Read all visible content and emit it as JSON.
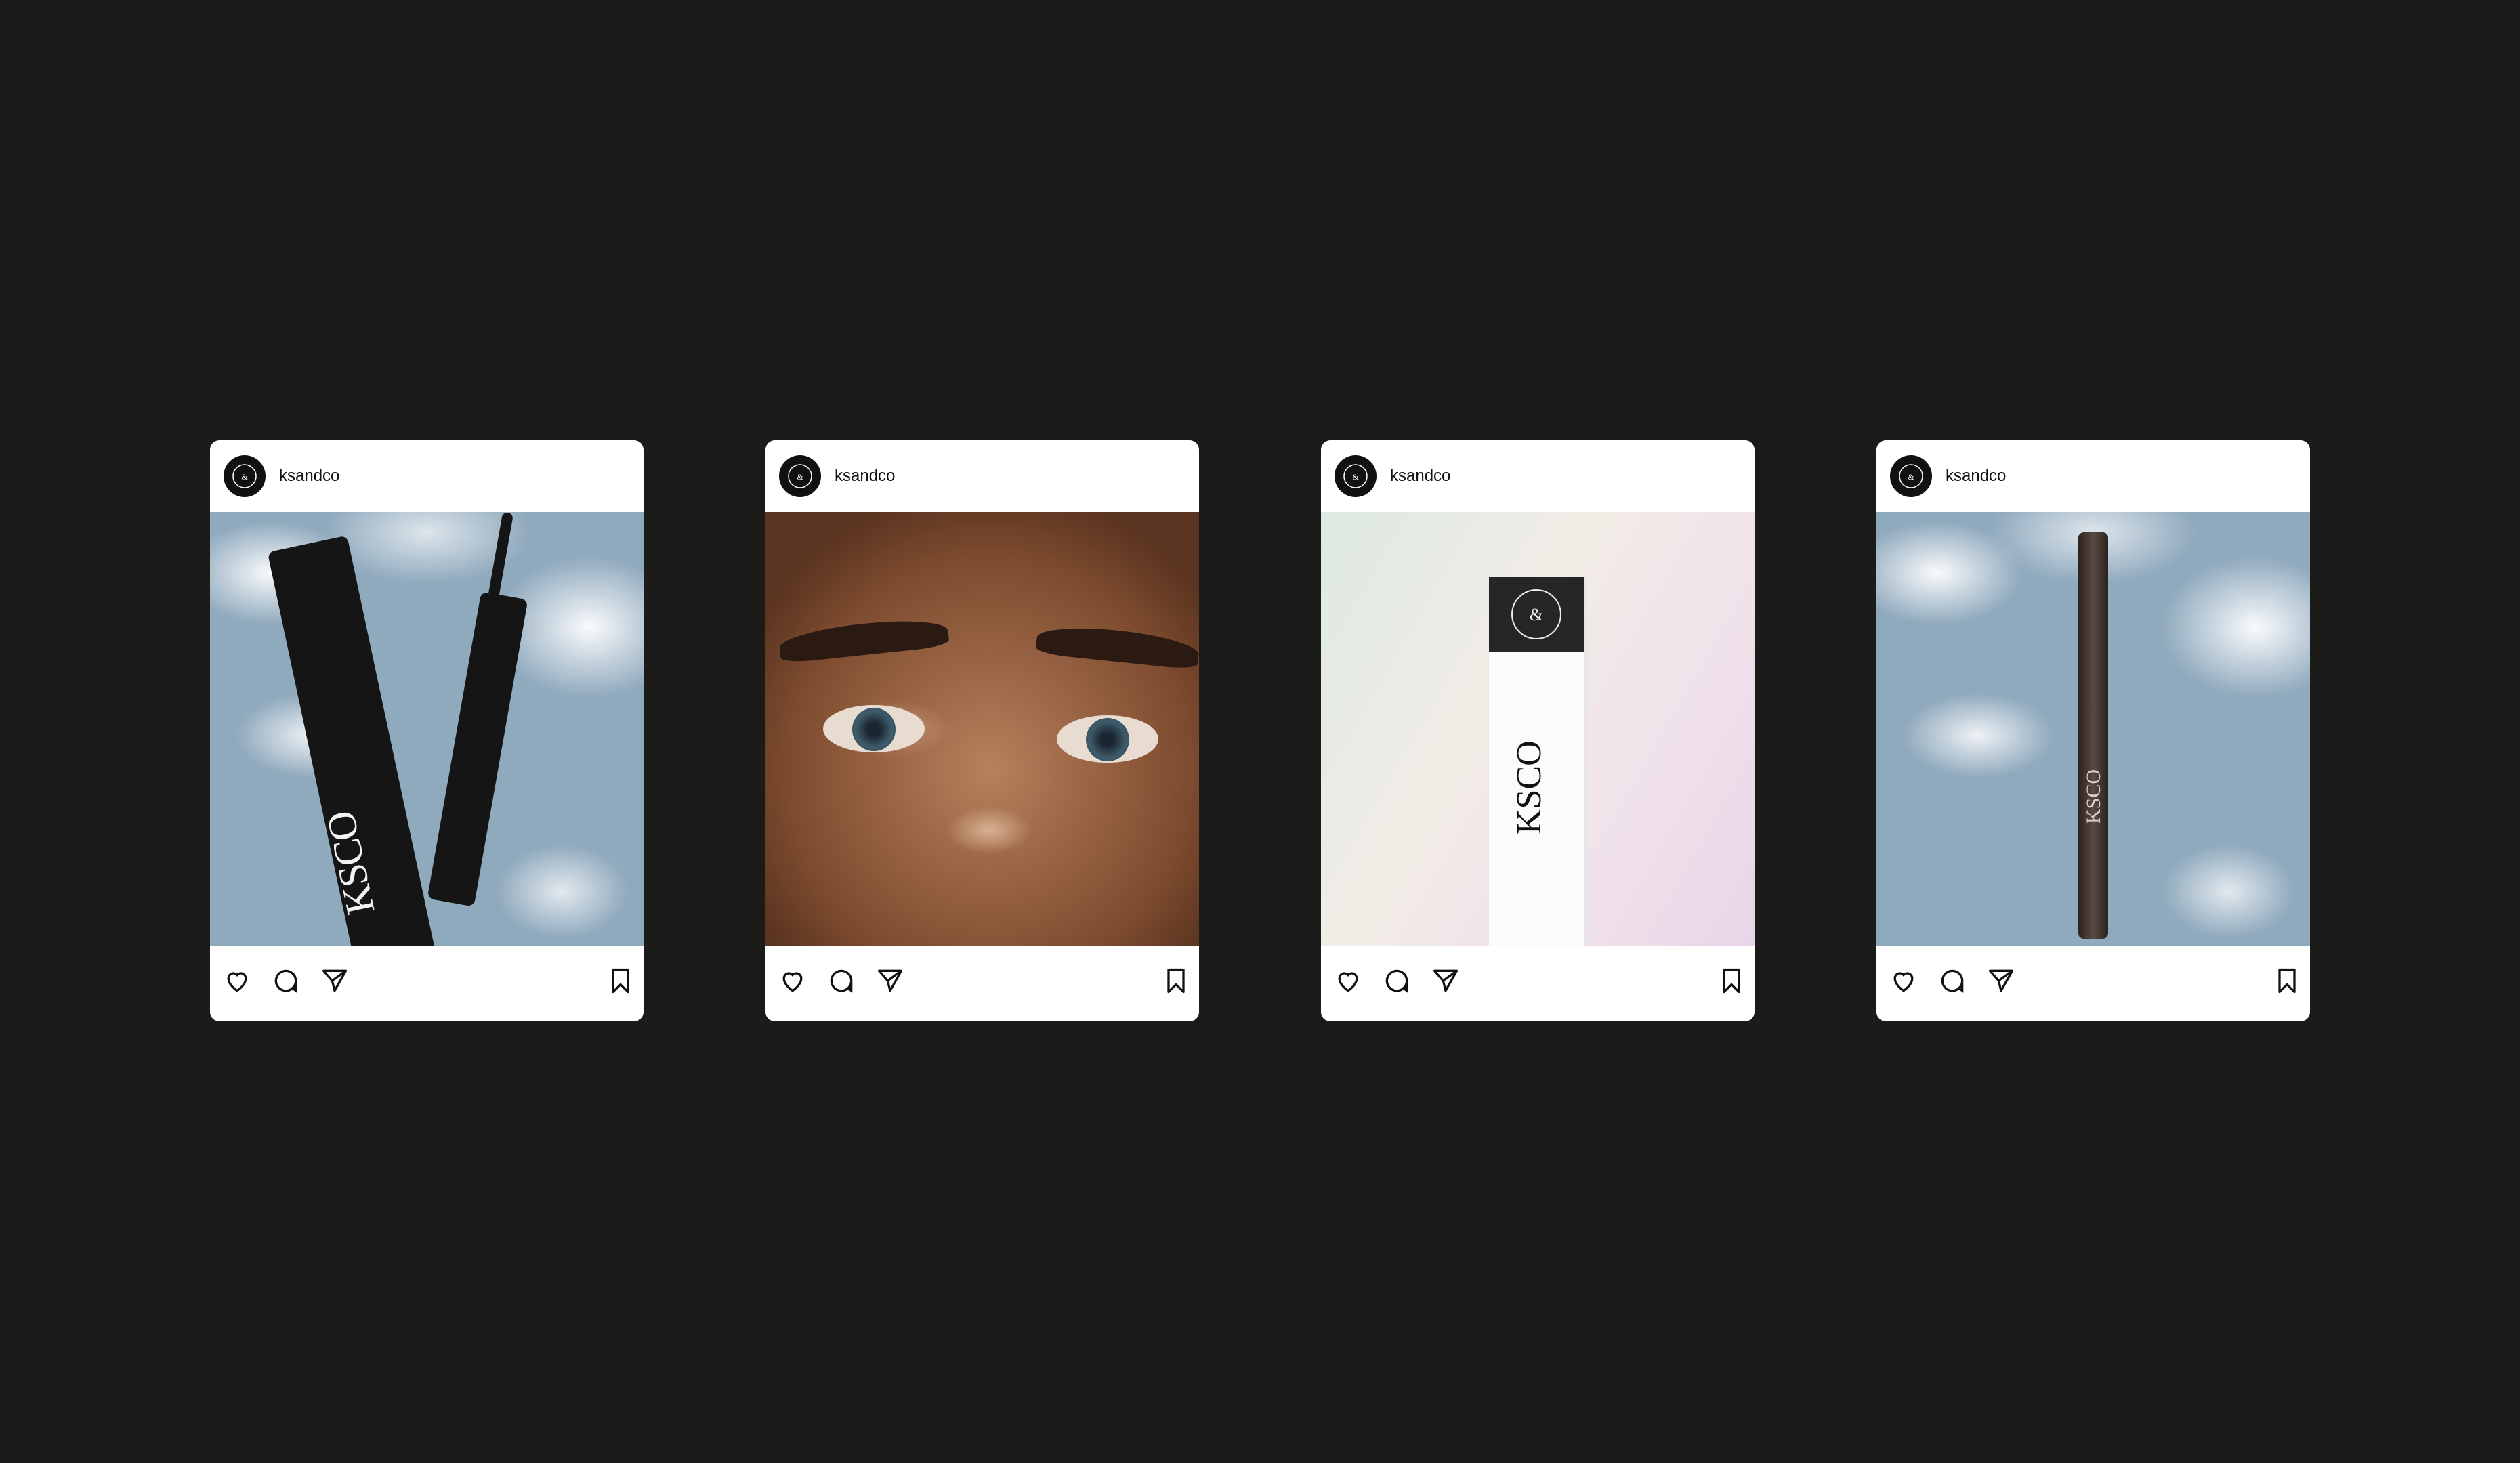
{
  "posts": [
    {
      "username": "ksandco",
      "image": "mascara-duo-sky",
      "brand_text": "KSCO"
    },
    {
      "username": "ksandco",
      "image": "eyebrow-closeup"
    },
    {
      "username": "ksandco",
      "image": "invisible-brow-gel-box",
      "brand_text": "KSCO"
    },
    {
      "username": "ksandco",
      "image": "brow-pen-sky",
      "brand_text": "KSCO"
    }
  ],
  "icons": {
    "avatar": "ksandco-logo-icon",
    "like": "heart-icon",
    "comment": "comment-icon",
    "share": "send-icon",
    "save": "bookmark-icon"
  },
  "colors": {
    "background": "#1b1c1a",
    "card": "#ffffff",
    "text": "#111111"
  }
}
